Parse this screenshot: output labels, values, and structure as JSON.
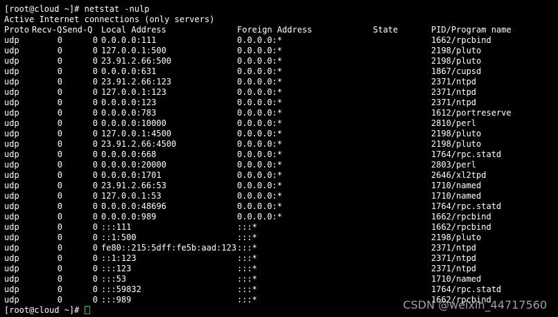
{
  "terminal": {
    "prompt_cmd": "[root@cloud ~]# netstat -nulp",
    "banner": "Active Internet connections (only servers)",
    "headers": {
      "proto": "Proto",
      "recvq": "Recv-Q",
      "sendq": "Send-Q",
      "local": "Local Address",
      "foreign": "Foreign Address",
      "state": "State",
      "pid": "PID/Program name"
    },
    "rows": [
      {
        "proto": "udp",
        "recvq": "0",
        "sendq": "0",
        "local": "0.0.0.0:111",
        "foreign": "0.0.0.0:*",
        "state": "",
        "pid": "1662/rpcbind"
      },
      {
        "proto": "udp",
        "recvq": "0",
        "sendq": "0",
        "local": "127.0.0.1:500",
        "foreign": "0.0.0.0:*",
        "state": "",
        "pid": "2198/pluto"
      },
      {
        "proto": "udp",
        "recvq": "0",
        "sendq": "0",
        "local": "23.91.2.66:500",
        "foreign": "0.0.0.0:*",
        "state": "",
        "pid": "2198/pluto"
      },
      {
        "proto": "udp",
        "recvq": "0",
        "sendq": "0",
        "local": "0.0.0.0:631",
        "foreign": "0.0.0.0:*",
        "state": "",
        "pid": "1867/cupsd"
      },
      {
        "proto": "udp",
        "recvq": "0",
        "sendq": "0",
        "local": "23.91.2.66:123",
        "foreign": "0.0.0.0:*",
        "state": "",
        "pid": "2371/ntpd"
      },
      {
        "proto": "udp",
        "recvq": "0",
        "sendq": "0",
        "local": "127.0.0.1:123",
        "foreign": "0.0.0.0:*",
        "state": "",
        "pid": "2371/ntpd"
      },
      {
        "proto": "udp",
        "recvq": "0",
        "sendq": "0",
        "local": "0.0.0.0:123",
        "foreign": "0.0.0.0:*",
        "state": "",
        "pid": "2371/ntpd"
      },
      {
        "proto": "udp",
        "recvq": "0",
        "sendq": "0",
        "local": "0.0.0.0:783",
        "foreign": "0.0.0.0:*",
        "state": "",
        "pid": "1612/portreserve"
      },
      {
        "proto": "udp",
        "recvq": "0",
        "sendq": "0",
        "local": "0.0.0.0:10000",
        "foreign": "0.0.0.0:*",
        "state": "",
        "pid": "2810/perl"
      },
      {
        "proto": "udp",
        "recvq": "0",
        "sendq": "0",
        "local": "127.0.0.1:4500",
        "foreign": "0.0.0.0:*",
        "state": "",
        "pid": "2198/pluto"
      },
      {
        "proto": "udp",
        "recvq": "0",
        "sendq": "0",
        "local": "23.91.2.66:4500",
        "foreign": "0.0.0.0:*",
        "state": "",
        "pid": "2198/pluto"
      },
      {
        "proto": "udp",
        "recvq": "0",
        "sendq": "0",
        "local": "0.0.0.0:668",
        "foreign": "0.0.0.0:*",
        "state": "",
        "pid": "1764/rpc.statd"
      },
      {
        "proto": "udp",
        "recvq": "0",
        "sendq": "0",
        "local": "0.0.0.0:20000",
        "foreign": "0.0.0.0:*",
        "state": "",
        "pid": "2803/perl"
      },
      {
        "proto": "udp",
        "recvq": "0",
        "sendq": "0",
        "local": "0.0.0.0:1701",
        "foreign": "0.0.0.0:*",
        "state": "",
        "pid": "2646/xl2tpd"
      },
      {
        "proto": "udp",
        "recvq": "0",
        "sendq": "0",
        "local": "23.91.2.66:53",
        "foreign": "0.0.0.0:*",
        "state": "",
        "pid": "1710/named"
      },
      {
        "proto": "udp",
        "recvq": "0",
        "sendq": "0",
        "local": "127.0.0.1:53",
        "foreign": "0.0.0.0:*",
        "state": "",
        "pid": "1710/named"
      },
      {
        "proto": "udp",
        "recvq": "0",
        "sendq": "0",
        "local": "0.0.0.0:48696",
        "foreign": "0.0.0.0:*",
        "state": "",
        "pid": "1764/rpc.statd"
      },
      {
        "proto": "udp",
        "recvq": "0",
        "sendq": "0",
        "local": "0.0.0.0:989",
        "foreign": "0.0.0.0:*",
        "state": "",
        "pid": "1662/rpcbind"
      },
      {
        "proto": "udp",
        "recvq": "0",
        "sendq": "0",
        "local": ":::111",
        "foreign": ":::*",
        "state": "",
        "pid": "1662/rpcbind"
      },
      {
        "proto": "udp",
        "recvq": "0",
        "sendq": "0",
        "local": "::1:500",
        "foreign": ":::*",
        "state": "",
        "pid": "2198/pluto"
      },
      {
        "proto": "udp",
        "recvq": "0",
        "sendq": "0",
        "local": "fe80::215:5dff:fe5b:aad:123",
        "foreign": ":::*",
        "state": "",
        "pid": "2371/ntpd"
      },
      {
        "proto": "udp",
        "recvq": "0",
        "sendq": "0",
        "local": "::1:123",
        "foreign": ":::*",
        "state": "",
        "pid": "2371/ntpd"
      },
      {
        "proto": "udp",
        "recvq": "0",
        "sendq": "0",
        "local": ":::123",
        "foreign": ":::*",
        "state": "",
        "pid": "2371/ntpd"
      },
      {
        "proto": "udp",
        "recvq": "0",
        "sendq": "0",
        "local": ":::53",
        "foreign": ":::*",
        "state": "",
        "pid": "1710/named"
      },
      {
        "proto": "udp",
        "recvq": "0",
        "sendq": "0",
        "local": ":::59832",
        "foreign": ":::*",
        "state": "",
        "pid": "1764/rpc.statd"
      },
      {
        "proto": "udp",
        "recvq": "0",
        "sendq": "0",
        "local": ":::989",
        "foreign": ":::*",
        "state": "",
        "pid": "1662/rpcbind"
      }
    ],
    "final_prompt": "[root@cloud ~]# ",
    "cursor_color": "#22c55e"
  },
  "watermark": {
    "text": "CSDN @weixin_44717560"
  },
  "colors": {
    "background": "#000000",
    "foreground": "#ffffff"
  }
}
